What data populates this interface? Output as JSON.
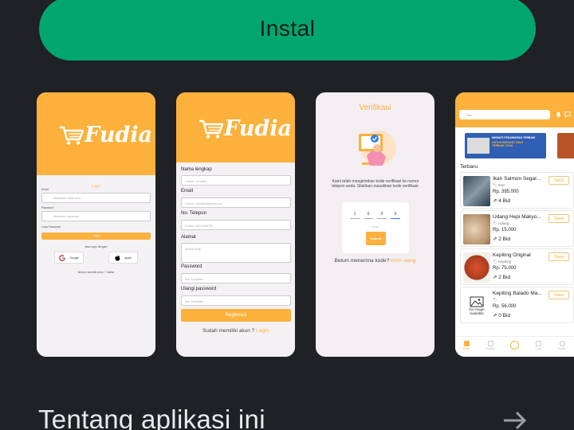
{
  "install_button": {
    "label": "Instal"
  },
  "about": {
    "title": "Tentang aplikasi ini"
  },
  "colors": {
    "background": "#202124",
    "install": "#01a66f",
    "brand": "#fbb13c"
  },
  "screenshots": {
    "login": {
      "logo": "Fudia",
      "heading": "Login",
      "email_label": "Email",
      "email_placeholder": "Masukkan email anda",
      "password_label": "Password",
      "password_placeholder": "Masukkan password",
      "forgot": "Lupa Password",
      "login_button": "Login",
      "or_text": "atau login dengan",
      "google": "Google",
      "apple": "Apple",
      "register_prompt": "Belum memiliki akun ? Daftar"
    },
    "register": {
      "logo": "Fudia",
      "fields": [
        {
          "label": "Nama lengkap",
          "placeholder": "Contoh: Junaidha"
        },
        {
          "label": "Email",
          "placeholder": "Contoh: Junaidha@gmail.com"
        },
        {
          "label": "No. Telepon",
          "placeholder": "Contoh: 08123456789"
        },
        {
          "label": "Alamat",
          "placeholder": "Alamat anda"
        },
        {
          "label": "Password",
          "placeholder": "Min. 8 karakter"
        },
        {
          "label": "Ulangi password",
          "placeholder": "Min. 8 karakter"
        }
      ],
      "register_button": "Registrasi",
      "footer_text": "Sudah memiliki akun ?",
      "footer_link": "Login"
    },
    "verify": {
      "title": "Verifikasi",
      "message": "Kami telah mengirimkan kode verifikasi ke nomor telepon anda. Silahkan masukkan kode verifikasi.",
      "digits": [
        "1",
        "0",
        "0",
        "0"
      ],
      "timer": "00:30",
      "submit": "Submit",
      "footer_text": "Belum menerima kode?",
      "footer_link": "kirim ulang"
    },
    "home": {
      "search_placeholder": "Cari",
      "banner_line1": "NIKMATI PENAWARAN TERBAIK",
      "banner_line2": "UNTUK BARANG YANG",
      "banner_line3": "TERBAIK JUGA",
      "section": "Terbaru",
      "items": [
        {
          "name": "Ikan Salmon Segar...",
          "category": "Ikan",
          "price": "Rp. 395.000",
          "bids": "4 Bid",
          "action": "Tawar"
        },
        {
          "name": "Udang Hepi Makyo...",
          "category": "Udang",
          "price": "Rp. 15.000",
          "bids": "2 Bid",
          "action": "Tawar"
        },
        {
          "name": "Kepiting Original",
          "category": "Kepiting",
          "price": "Rp. 75.000",
          "bids": "2 Bid",
          "action": "Tawar"
        },
        {
          "name": "Kepiting Balado Ma...",
          "category": "",
          "price": "Rp. 56.000",
          "bids": "0 Bid",
          "action": "Tawar"
        }
      ],
      "no_image": "No image available",
      "nav": [
        "Home",
        "Produk",
        "",
        "Chat",
        "Profile"
      ]
    }
  }
}
